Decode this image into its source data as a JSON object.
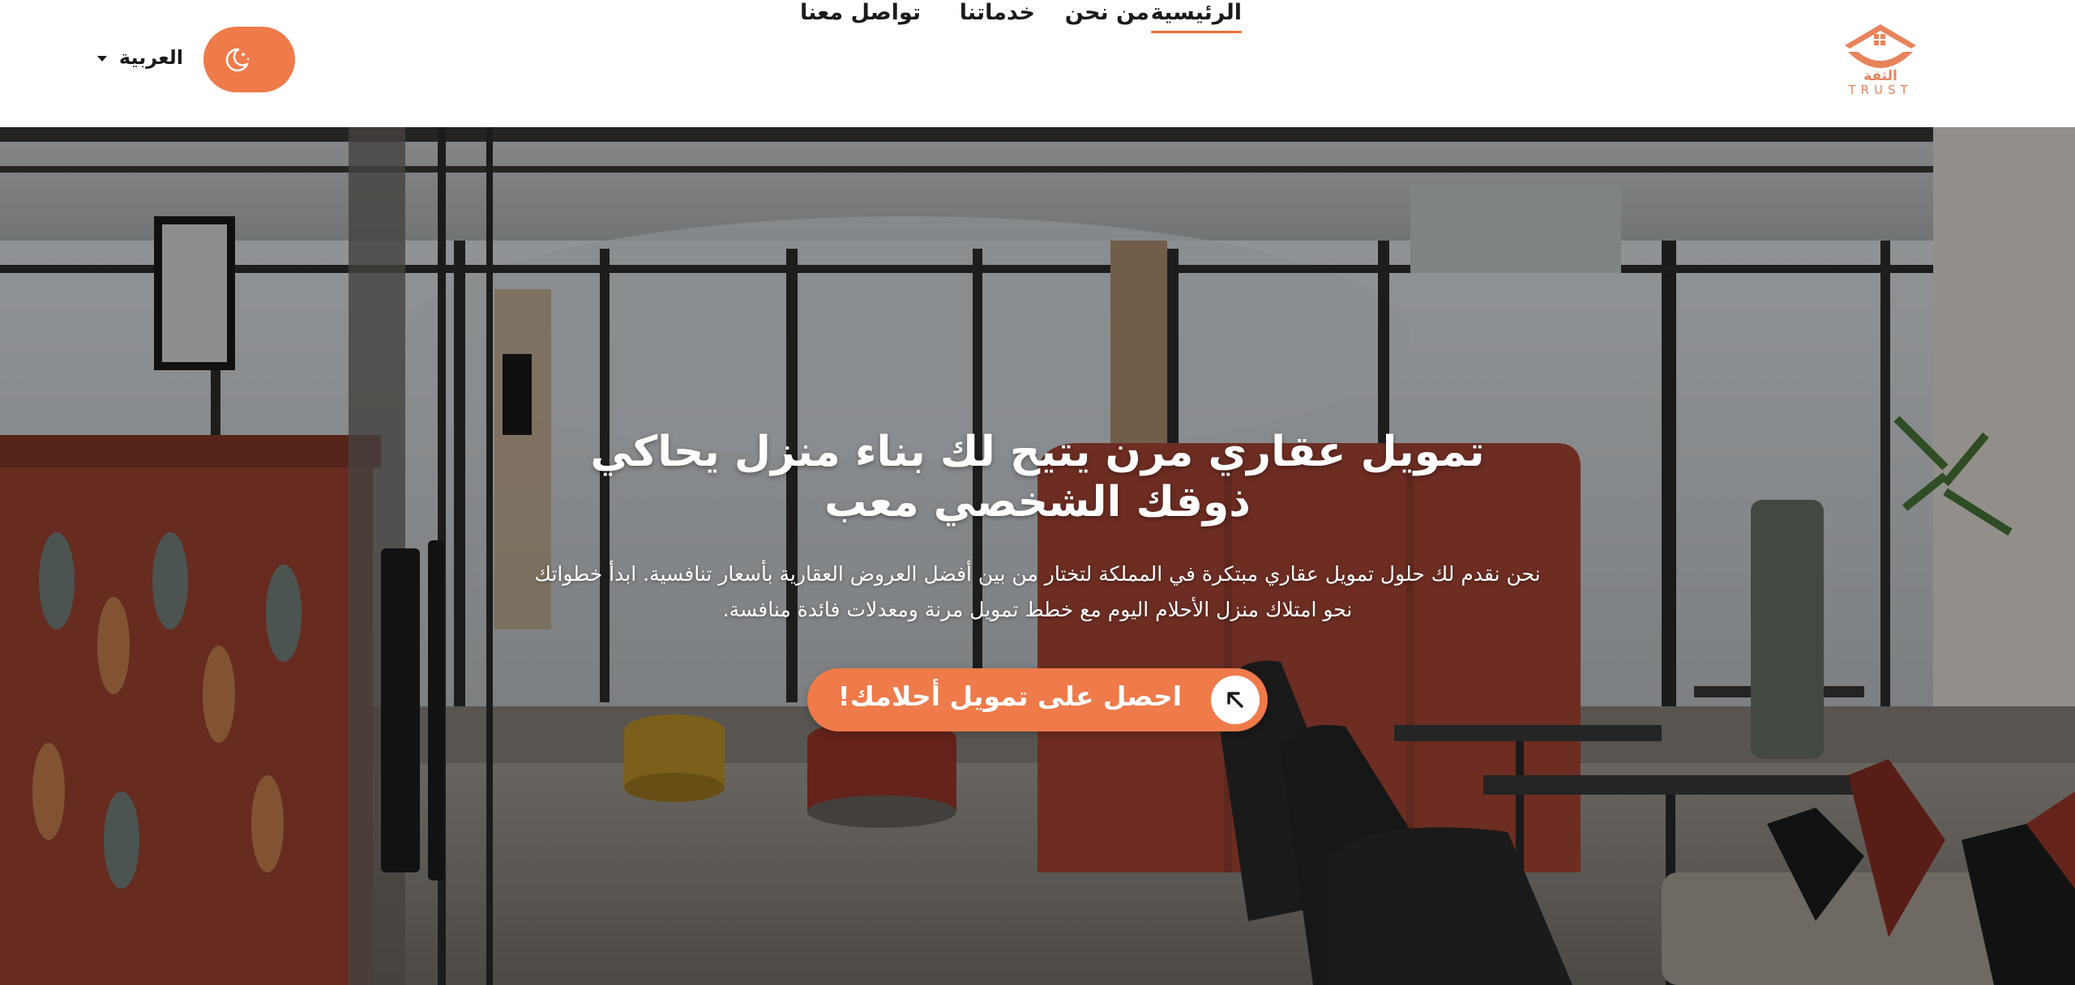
{
  "header": {
    "logo": {
      "arabic": "الثقة",
      "latin": "TRUST",
      "icon": "house-handshake-logo"
    },
    "nav": [
      {
        "label": "الرئيسية",
        "active": true
      },
      {
        "label": "من نحن",
        "active": false
      },
      {
        "label": "خدماتنا",
        "active": false
      },
      {
        "label": "تواصل معنا",
        "active": false
      }
    ],
    "theme_toggle": {
      "icon": "moon-stars-icon"
    },
    "language": {
      "selected": "العربية",
      "icon": "caret-down-icon"
    }
  },
  "hero": {
    "title": "تمويل عقاري مرن يتيح لك بناء منزل يحاكي ذوقك الشخصي معب",
    "subtitle": "نحن نقدم لك حلول تمويل عقاري مبتكرة في المملكة لتختار من بين أفضل العروض العقارية بأسعار تنافسية. ابدأ خطواتك نحو امتلاك منزل الأحلام اليوم مع خطط تمويل مرنة ومعدلات فائدة منافسة.",
    "cta": {
      "label": "احصل على تمويل أحلامك!",
      "icon": "arrow-up-left-icon"
    },
    "background": "office-lounge-photo"
  },
  "colors": {
    "accent": "#ef7a4a",
    "nav_underline": "#ef6c3a",
    "logo": "#e8835c",
    "text_dark": "#1b1b1b"
  }
}
